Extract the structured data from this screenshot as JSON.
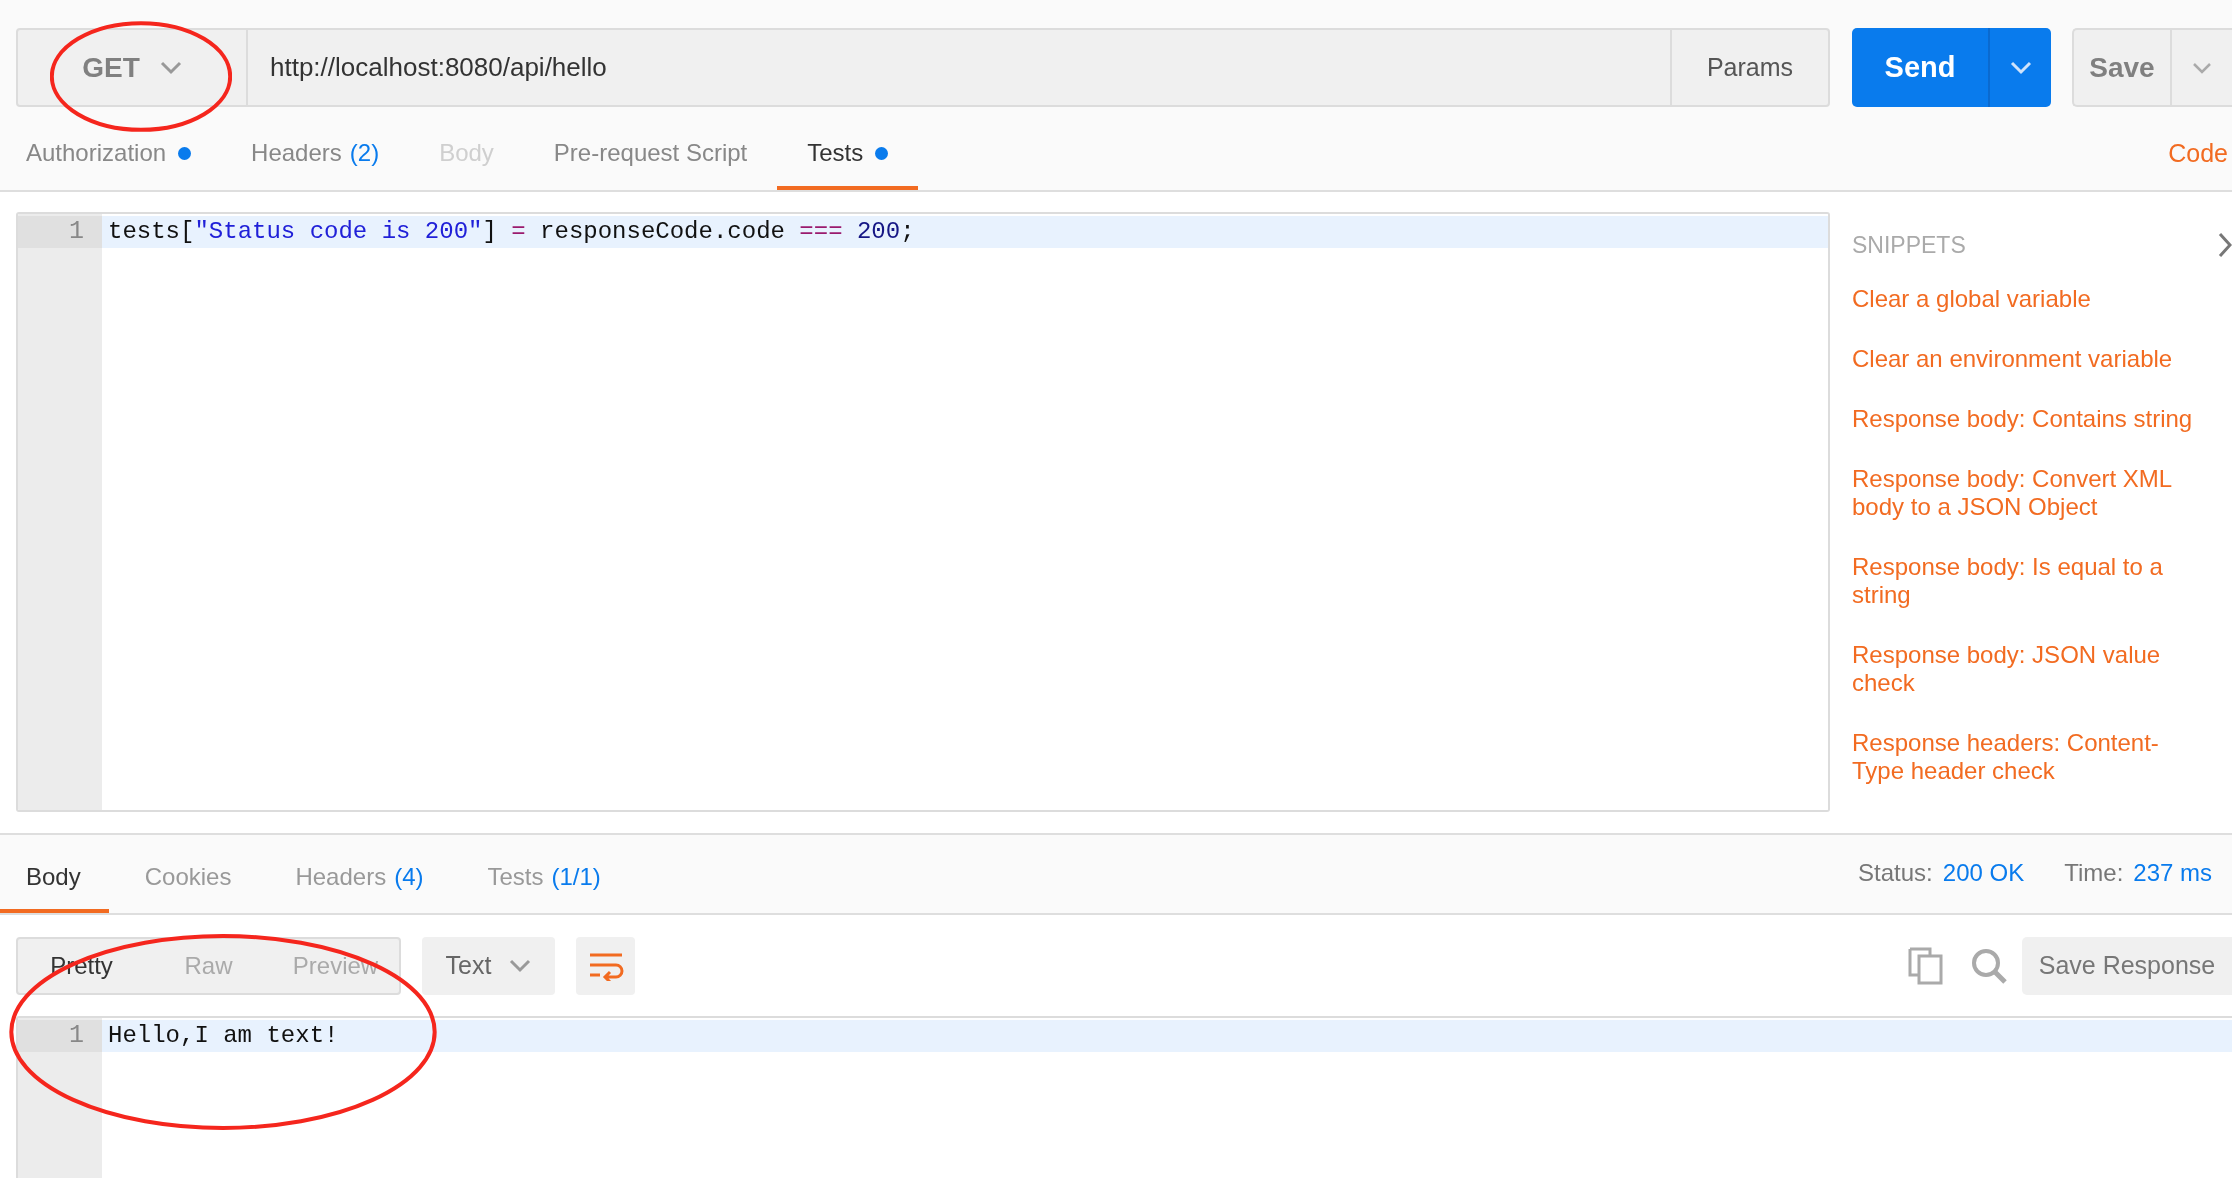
{
  "request": {
    "method": "GET",
    "method_circled": true,
    "url": "http://localhost:8080/api/hello",
    "params_label": "Params",
    "send_label": "Send",
    "save_label": "Save"
  },
  "request_tabs": [
    {
      "label": "Authorization",
      "dot": true,
      "disabled": false,
      "selected": false
    },
    {
      "label": "Headers",
      "count": "(2)",
      "dot": false,
      "disabled": false,
      "selected": false
    },
    {
      "label": "Body",
      "dot": false,
      "disabled": true,
      "selected": false
    },
    {
      "label": "Pre-request Script",
      "dot": false,
      "disabled": false,
      "selected": false
    },
    {
      "label": "Tests",
      "dot": true,
      "disabled": false,
      "selected": true
    }
  ],
  "code_link": "Code",
  "test_editor": {
    "lines": [
      {
        "number": "1",
        "highlighted": true,
        "tokens": [
          {
            "kind": "plain",
            "text": "tests["
          },
          {
            "kind": "string",
            "text": "\"Status code is 200\""
          },
          {
            "kind": "plain",
            "text": "] "
          },
          {
            "kind": "operator",
            "text": "="
          },
          {
            "kind": "plain",
            "text": " responseCode.code "
          },
          {
            "kind": "operator",
            "text": "==="
          },
          {
            "kind": "number",
            "text": " 200"
          },
          {
            "kind": "plain",
            "text": ";"
          }
        ]
      }
    ]
  },
  "snippets": {
    "title": "SNIPPETS",
    "items": [
      "Clear a global variable",
      "Clear an environment variable",
      "Response body: Contains string",
      "Response body: Convert XML body to a JSON Object",
      "Response body: Is equal to a string",
      "Response body: JSON value check",
      "Response headers: Content-Type header check"
    ]
  },
  "response_tabs": [
    {
      "label": "Body",
      "selected": true
    },
    {
      "label": "Cookies",
      "selected": false
    },
    {
      "label": "Headers",
      "count": "(4)",
      "selected": false
    },
    {
      "label": "Tests",
      "count": "(1/1)",
      "selected": false
    }
  ],
  "status": {
    "label": "Status:",
    "value": "200 OK"
  },
  "time": {
    "label": "Time:",
    "value": "237 ms"
  },
  "view_modes": [
    {
      "label": "Pretty",
      "selected": true
    },
    {
      "label": "Raw",
      "selected": false
    },
    {
      "label": "Preview",
      "selected": false
    }
  ],
  "format": "Text",
  "save_response": "Save Response",
  "response_editor": {
    "circled": true,
    "lines": [
      {
        "number": "1",
        "highlighted": true,
        "text": "Hello,I am text!"
      }
    ]
  }
}
